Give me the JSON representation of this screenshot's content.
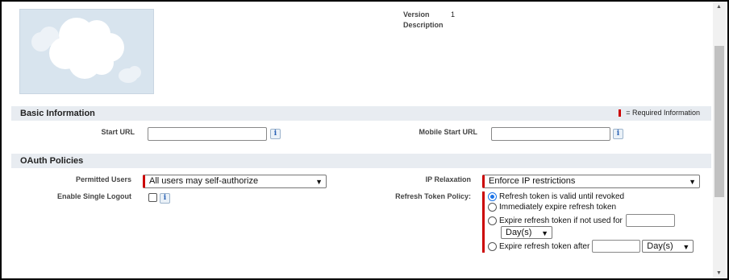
{
  "meta": {
    "version_label": "Version",
    "version_value": "1",
    "description_label": "Description"
  },
  "required_legend": "= Required Information",
  "basic_info": {
    "title": "Basic Information",
    "start_url_label": "Start URL",
    "start_url_value": "",
    "mobile_start_url_label": "Mobile Start URL",
    "mobile_start_url_value": ""
  },
  "oauth": {
    "title": "OAuth Policies",
    "permitted_users_label": "Permitted Users",
    "permitted_users_value": "All users may self-authorize",
    "ip_relaxation_label": "IP Relaxation",
    "ip_relaxation_value": "Enforce IP restrictions",
    "single_logout_label": "Enable Single Logout",
    "single_logout_checked": false,
    "refresh_policy_label": "Refresh Token Policy:",
    "refresh_options": [
      "Refresh token is valid until revoked",
      "Immediately expire refresh token",
      "Expire refresh token if not used for",
      "Expire refresh token after"
    ],
    "refresh_selected_index": 0,
    "unit_select_1": "Day(s)",
    "unit_select_2": "Day(s)"
  },
  "icons": {
    "info": "i",
    "chevron": "▼",
    "scroll_up": "▲",
    "scroll_down": "▼"
  },
  "colors": {
    "required": "#cc0000",
    "section_bg": "#e8ecf1",
    "logo_bg": "#d8e4ee"
  }
}
